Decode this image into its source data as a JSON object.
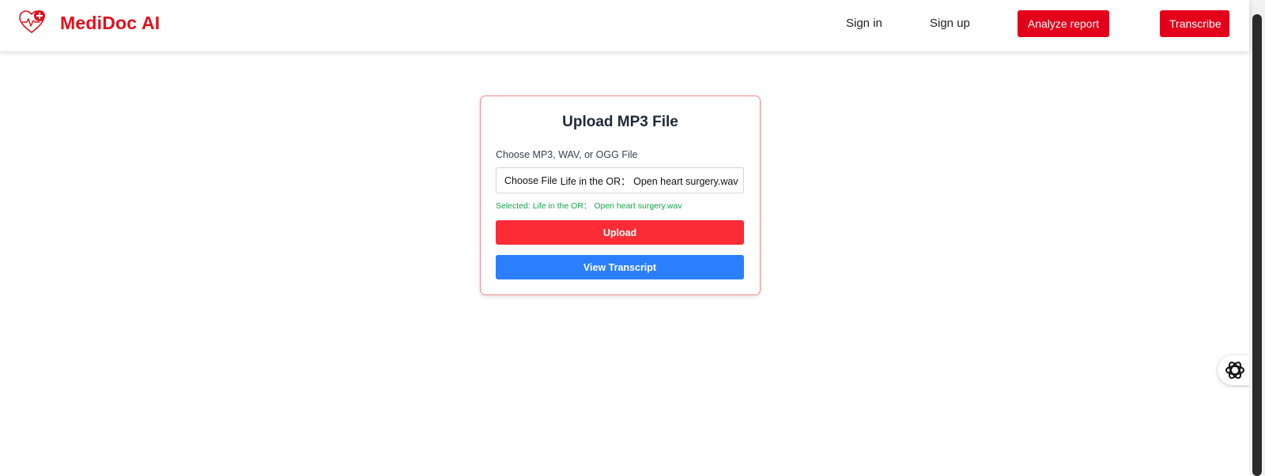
{
  "brand": {
    "name": "MediDoc AI",
    "logo_icon": "heart-pulse-plus-icon",
    "color": "#e0101c"
  },
  "nav": {
    "sign_in": "Sign in",
    "sign_up": "Sign up",
    "analyze_report": "Analyze report",
    "transcribe": "Transcribe",
    "accent": "#e3001b"
  },
  "upload_card": {
    "title": "Upload MP3 File",
    "file_label": "Choose MP3, WAV, or OGG File",
    "file_button": "Choose File",
    "file_name": "Life in the OR： Open heart surgery.wav",
    "selected_text": "Selected: Life in the OR： Open heart surgery.wav",
    "upload_label": "Upload",
    "view_transcript_label": "View Transcript",
    "upload_color": "#fb2c36",
    "view_color": "#2b7fff",
    "selected_color": "#16a34a"
  },
  "widgets": {
    "chat_icon": "assistant-knot-icon"
  }
}
